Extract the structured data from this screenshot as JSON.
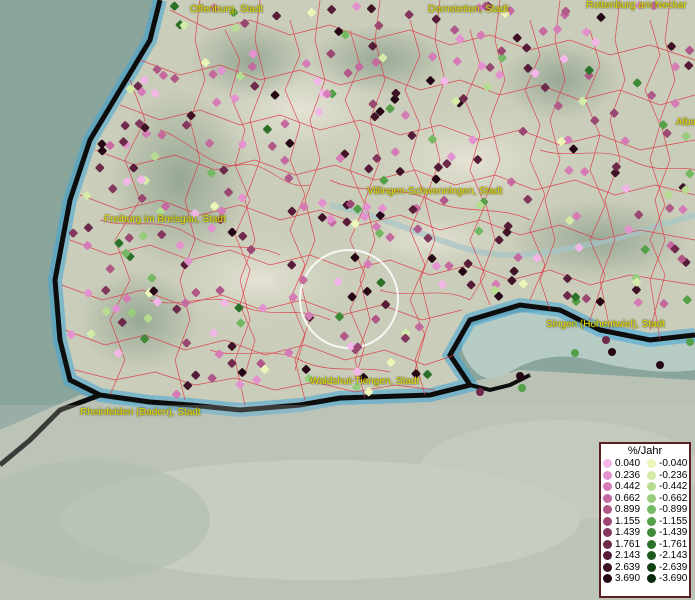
{
  "map": {
    "labels": [
      {
        "id": "offenburg",
        "text": "Offenburg, Stadt"
      },
      {
        "id": "dornstetten",
        "text": "Dornstetten, Stadt"
      },
      {
        "id": "rottenburg",
        "text": "Rottenburg am Neckar"
      },
      {
        "id": "albstadt",
        "text": "Albs"
      },
      {
        "id": "freiburg",
        "text": "Freiburg im Breisgau, Stadt"
      },
      {
        "id": "villingen",
        "text": "Villingen-Schwenningen, Stadt"
      },
      {
        "id": "singen",
        "text": "Singen (Hohentwiel), Stadt"
      },
      {
        "id": "waldshut",
        "text": "Waldshut-Tiengen, Stadt"
      },
      {
        "id": "rheinfelden",
        "text": "Rheinfelden (Baden), Stadt"
      }
    ]
  },
  "legend": {
    "title": "%/Jahr",
    "positive": [
      {
        "label": "0.040",
        "color": "#f2b6e8"
      },
      {
        "label": "0.236",
        "color": "#e492cf"
      },
      {
        "label": "0.442",
        "color": "#d57bb6"
      },
      {
        "label": "0.662",
        "color": "#c46a9f"
      },
      {
        "label": "0.899",
        "color": "#b05888"
      },
      {
        "label": "1.155",
        "color": "#9a4772"
      },
      {
        "label": "1.439",
        "color": "#84385e"
      },
      {
        "label": "1.761",
        "color": "#6e2a4b"
      },
      {
        "label": "2.143",
        "color": "#571d38"
      },
      {
        "label": "2.639",
        "color": "#3f1226"
      },
      {
        "label": "3.690",
        "color": "#250715"
      }
    ],
    "negative": [
      {
        "label": "-0.040",
        "color": "#eef5b8"
      },
      {
        "label": "-0.236",
        "color": "#d3eba7"
      },
      {
        "label": "-0.442",
        "color": "#b6dc91"
      },
      {
        "label": "-0.662",
        "color": "#96cc7b"
      },
      {
        "label": "-0.899",
        "color": "#74b863"
      },
      {
        "label": "-1.155",
        "color": "#55a14a"
      },
      {
        "label": "-1.439",
        "color": "#3f8a38"
      },
      {
        "label": "-1.761",
        "color": "#2c7129"
      },
      {
        "label": "-2.143",
        "color": "#1d5a1e"
      },
      {
        "label": "-2.639",
        "color": "#114214"
      },
      {
        "label": "-3.690",
        "color": "#06280a"
      }
    ]
  }
}
